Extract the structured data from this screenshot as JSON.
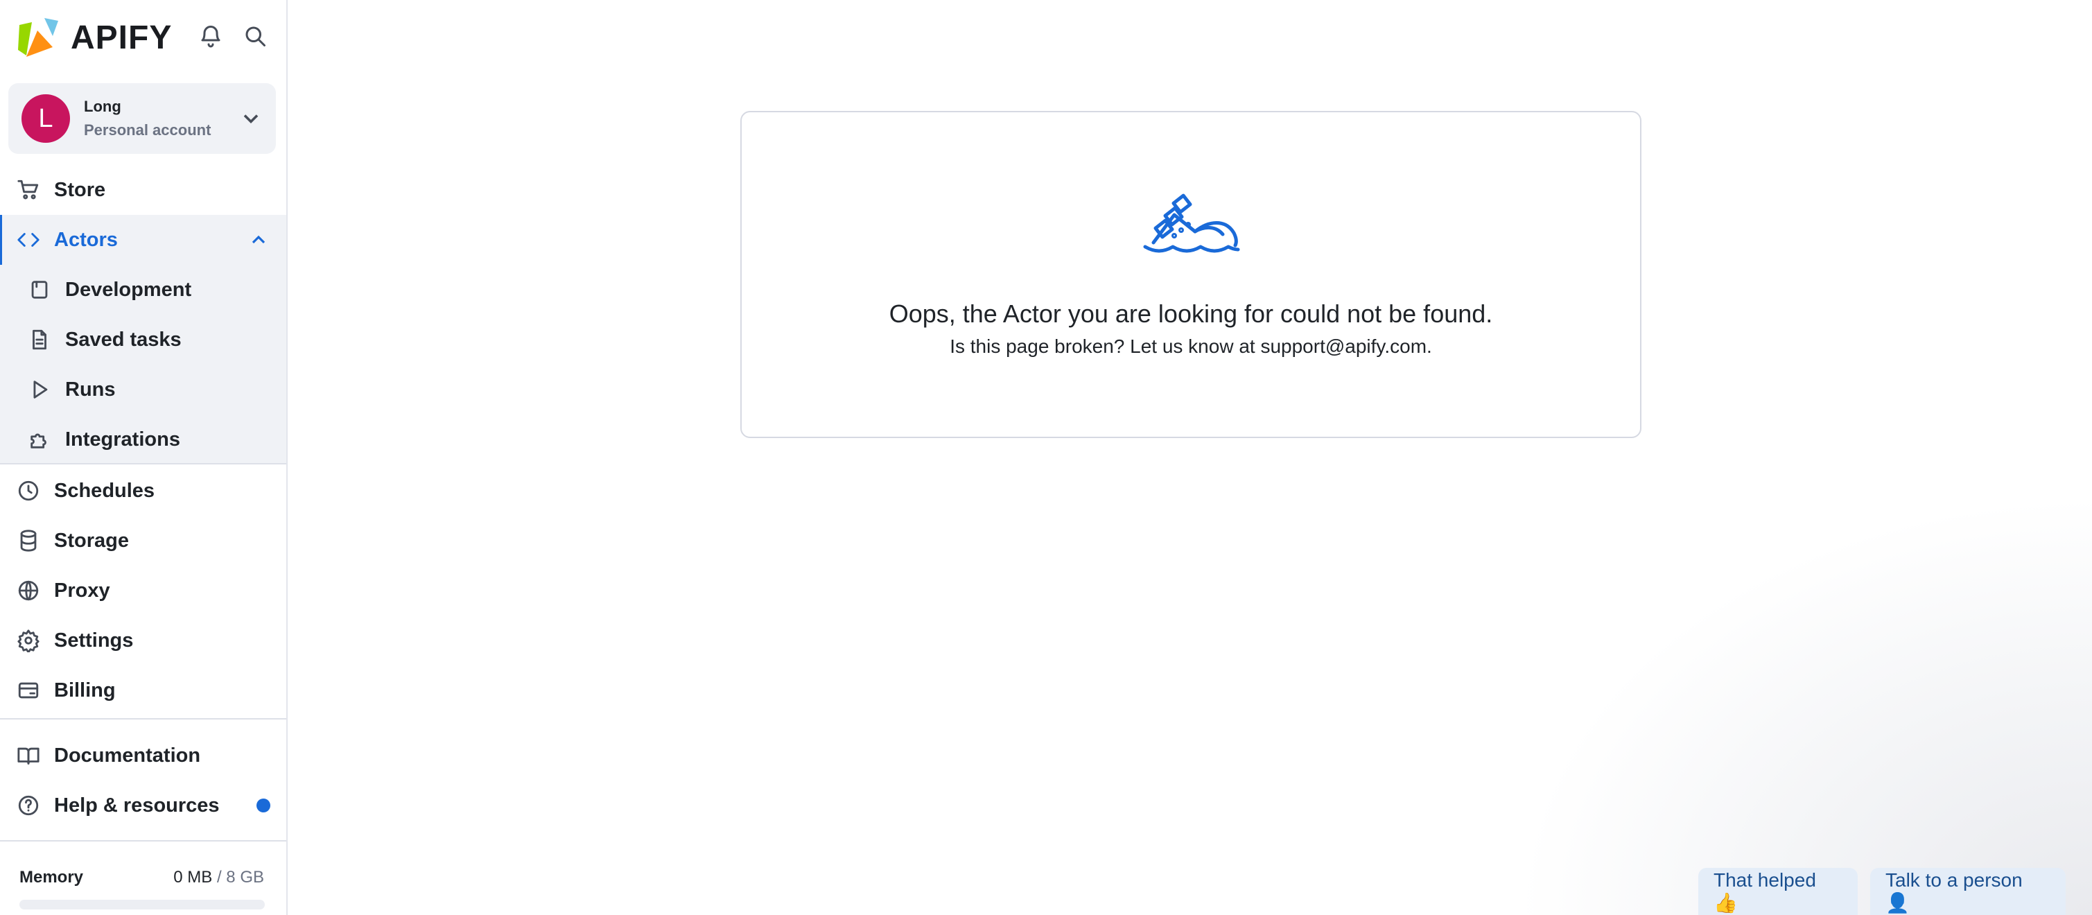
{
  "brand": {
    "name": "APIFY"
  },
  "account": {
    "initial": "L",
    "name": "Long",
    "type": "Personal account"
  },
  "nav": {
    "store": "Store",
    "actors": "Actors",
    "development": "Development",
    "saved_tasks": "Saved tasks",
    "runs": "Runs",
    "integrations": "Integrations",
    "schedules": "Schedules",
    "storage": "Storage",
    "proxy": "Proxy",
    "settings": "Settings",
    "billing": "Billing",
    "documentation": "Documentation",
    "help": "Help & resources"
  },
  "memory": {
    "label": "Memory",
    "used": "0 MB",
    "separator": " / ",
    "total": "8 GB",
    "fraction": 0
  },
  "error": {
    "title": "Oops, the Actor you are looking for could not be found.",
    "subtitle": "Is this page broken? Let us know at support@apify.com."
  },
  "feedback": {
    "helped": "That helped 👍",
    "talk": "Talk to a person 👤"
  },
  "colors": {
    "accent": "#1a6ad8",
    "avatar": "#c8155e"
  },
  "icons": [
    "bell-icon",
    "search-icon",
    "cart-icon",
    "code-icon",
    "development-icon",
    "document-icon",
    "play-icon",
    "puzzle-icon",
    "clock-icon",
    "database-icon",
    "globe-icon",
    "gear-icon",
    "credit-card-icon",
    "book-icon",
    "question-icon",
    "sinking-ship-icon"
  ]
}
